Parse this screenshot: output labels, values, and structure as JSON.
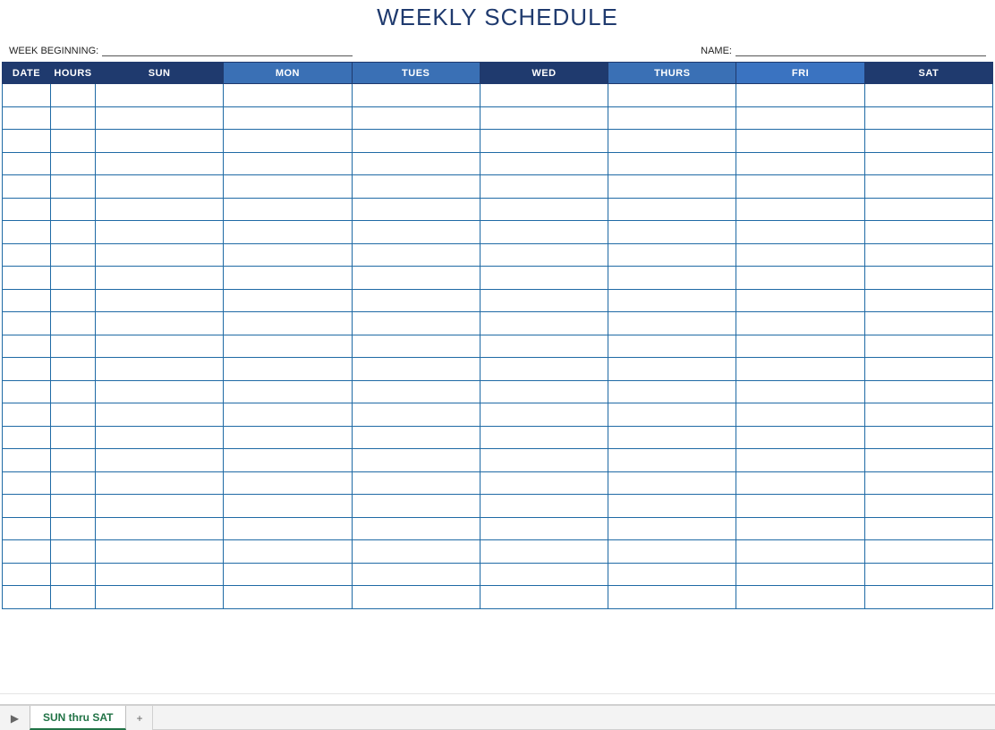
{
  "title": "WEEKLY SCHEDULE",
  "meta": {
    "week_beginning_label": "WEEK BEGINNING:",
    "week_beginning_value": "",
    "name_label": "NAME:",
    "name_value": ""
  },
  "columns": {
    "date": "DATE",
    "hours": "HOURS",
    "sun": "SUN",
    "mon": "MON",
    "tues": "TUES",
    "wed": "WED",
    "thurs": "THURS",
    "fri": "FRI",
    "sat": "SAT"
  },
  "row_count": 23,
  "tabs": {
    "active": "SUN thru SAT"
  },
  "icons": {
    "nav": "▶",
    "add": "+"
  },
  "colors": {
    "header_dark": "#1f3a6e",
    "header_mid": "#3a70b5",
    "grid_border": "#1f6aa5",
    "tab_accent": "#217346"
  }
}
